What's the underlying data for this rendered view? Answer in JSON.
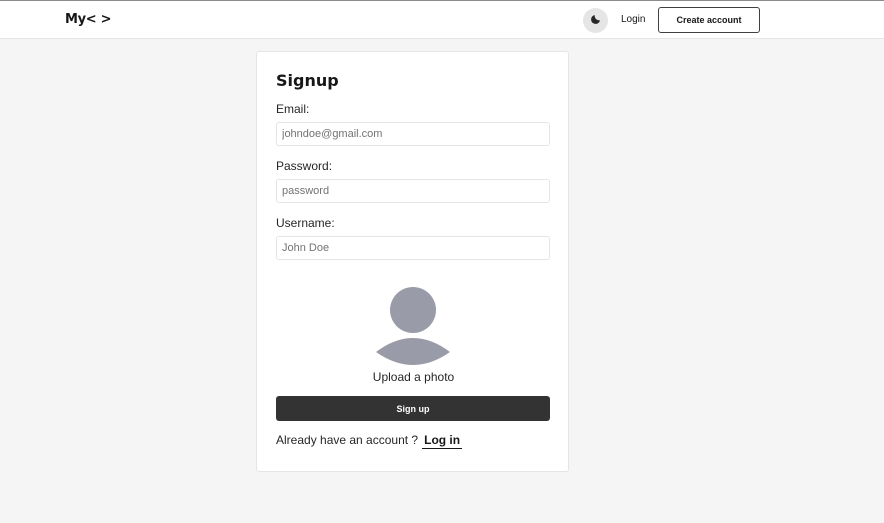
{
  "header": {
    "logo": "My< >",
    "theme_toggle_icon": "moon-icon",
    "login_label": "Login",
    "create_account_label": "Create account"
  },
  "form": {
    "title": "Signup",
    "email": {
      "label": "Email:",
      "placeholder": "johndoe@gmail.com",
      "value": ""
    },
    "password": {
      "label": "Password:",
      "placeholder": "password",
      "value": ""
    },
    "username": {
      "label": "Username:",
      "placeholder": "John Doe",
      "value": ""
    },
    "avatar_icon": "user-avatar-icon",
    "upload_label": "Upload a photo",
    "submit_label": "Sign up",
    "login_prompt": "Already have an account ?",
    "login_link": "Log in"
  },
  "colors": {
    "page_bg": "#f5f5f5",
    "button_dark": "#333333",
    "avatar_gray": "#9a9ba8"
  }
}
